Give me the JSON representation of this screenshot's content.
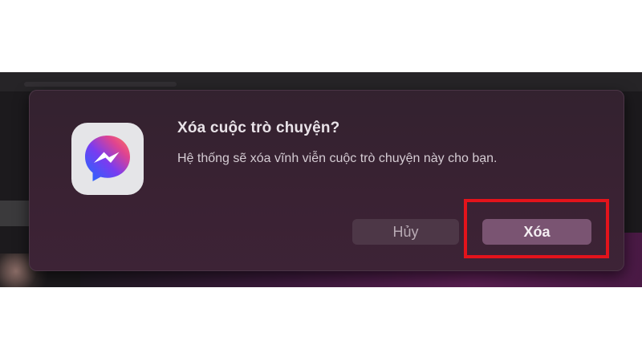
{
  "dialog": {
    "title": "Xóa cuộc trò chuyện?",
    "message": "Hệ thống sẽ xóa vĩnh viễn cuộc trò chuyện này cho bạn.",
    "cancel_label": "Hủy",
    "delete_label": "Xóa",
    "app_icon": "messenger-icon"
  },
  "colors": {
    "dialog_bg": "#3a2233",
    "delete_button": "#7a5472",
    "cancel_button": "#4d3747",
    "highlight": "#e3131b"
  }
}
